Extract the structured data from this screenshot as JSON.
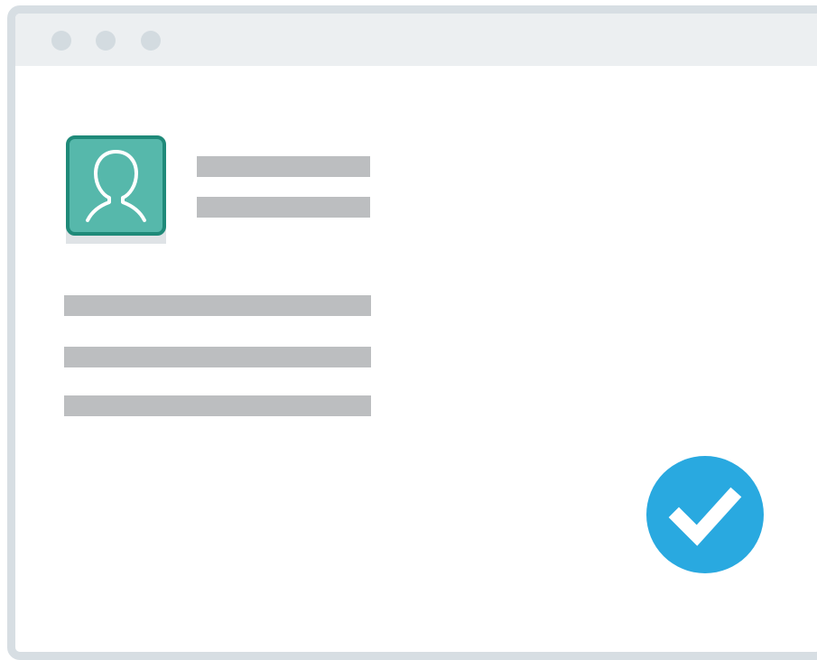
{
  "window": {
    "traffic_lights": [
      "window-dot",
      "window-dot",
      "window-dot"
    ]
  },
  "profile": {
    "avatar_icon": "user-silhouette-icon",
    "header_lines": 2,
    "content_lines": 3
  },
  "status": {
    "icon": "checkmark-icon",
    "color": "#29a9e0"
  },
  "colors": {
    "frame": "#d7dee3",
    "titlebar": "#eceff1",
    "placeholder": "#bcbec0",
    "avatar_fill": "#56b8ab",
    "avatar_border": "#1f8a79"
  }
}
